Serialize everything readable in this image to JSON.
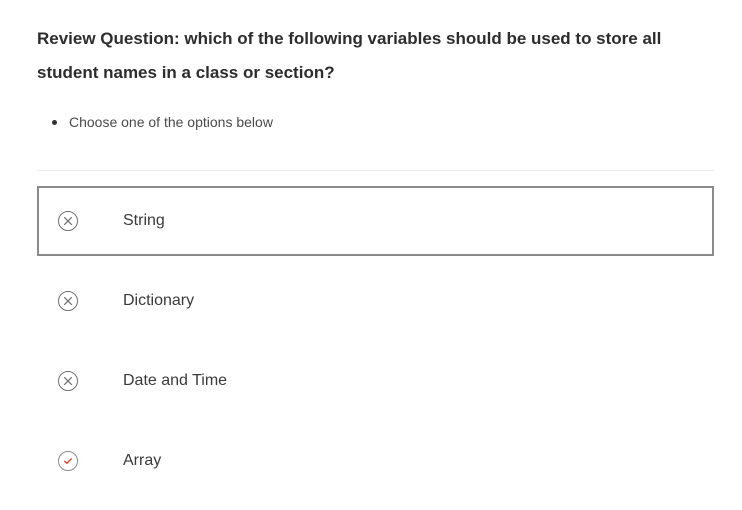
{
  "question": {
    "text": "Review Question: which of the following variables should be used to store all student names in a class or section?"
  },
  "instructions": [
    "Choose one of the options below"
  ],
  "colors": {
    "incorrect_icon": "#707070",
    "correct_icon": "#e2462b",
    "selected_border": "#8a8a8a"
  },
  "options": [
    {
      "label": "String",
      "status_icon": "x-circle-icon",
      "selected": true
    },
    {
      "label": "Dictionary",
      "status_icon": "x-circle-icon",
      "selected": false
    },
    {
      "label": "Date and Time",
      "status_icon": "x-circle-icon",
      "selected": false
    },
    {
      "label": "Array",
      "status_icon": "check-circle-icon",
      "selected": false
    }
  ]
}
